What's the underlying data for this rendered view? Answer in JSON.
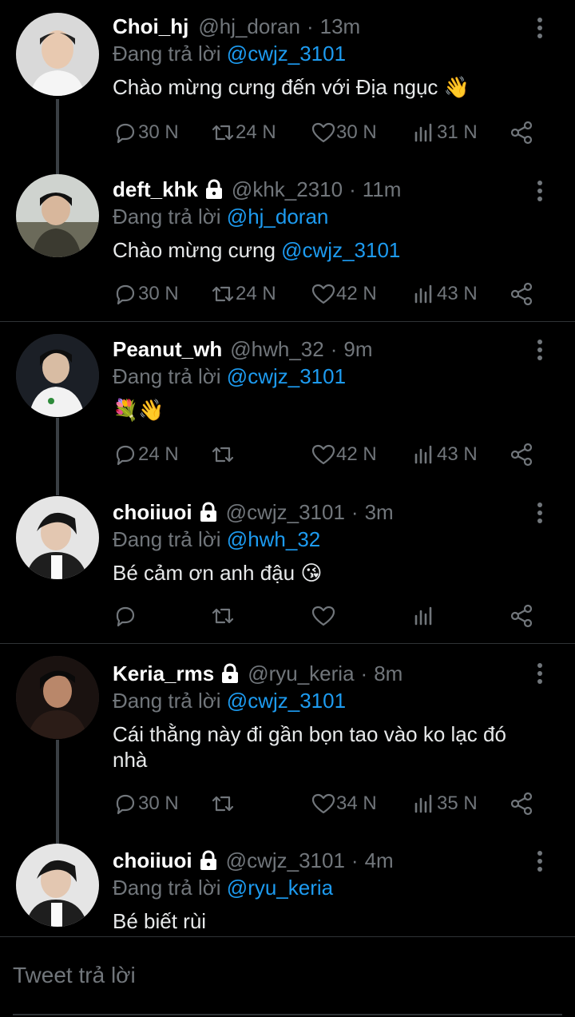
{
  "reply_prefix": "Đang trả lời",
  "tweets": [
    {
      "name": "Choi_hj",
      "handle": "@hj_doran",
      "time": "13m",
      "locked": false,
      "reply_to": "@cwjz_3101",
      "text_before": "Chào mừng cưng đến với Địa ngục ",
      "text_mention": "",
      "text_emoji": "👋",
      "replies": "30 N",
      "retweets": "24 N",
      "likes": "30 N",
      "views": "31 N"
    },
    {
      "name": "deft_khk",
      "handle": "@khk_2310",
      "time": "11m",
      "locked": true,
      "reply_to": "@hj_doran",
      "text_before": "Chào mừng cưng ",
      "text_mention": "@cwjz_3101",
      "text_emoji": "",
      "replies": "30 N",
      "retweets": "24 N",
      "likes": "42 N",
      "views": "43 N"
    },
    {
      "name": "Peanut_wh",
      "handle": "@hwh_32",
      "time": "9m",
      "locked": false,
      "reply_to": "@cwjz_3101",
      "text_before": "",
      "text_mention": "",
      "text_emoji": "💐👋",
      "replies": "24 N",
      "retweets": "",
      "likes": "42 N",
      "views": "43 N"
    },
    {
      "name": "choiiuoi",
      "handle": "@cwjz_3101",
      "time": "3m",
      "locked": true,
      "reply_to": "@hwh_32",
      "text_before": "Bé cảm ơn anh đậu ",
      "text_mention": "",
      "text_emoji": "😘",
      "replies": "",
      "retweets": "",
      "likes": "",
      "views": ""
    },
    {
      "name": "Keria_rms",
      "handle": "@ryu_keria",
      "time": "8m",
      "locked": true,
      "reply_to": "@cwjz_3101",
      "text_before": "Cái thằng này đi gần bọn tao vào ko lạc đó nhà",
      "text_mention": "",
      "text_emoji": "",
      "replies": "30 N",
      "retweets": "",
      "likes": "34 N",
      "views": "35 N"
    },
    {
      "name": "choiiuoi",
      "handle": "@cwjz_3101",
      "time": "4m",
      "locked": true,
      "reply_to": "@ryu_keria",
      "text_before": "Bé biết rùi",
      "text_mention": "",
      "text_emoji": "",
      "replies": "",
      "retweets": "",
      "likes": "",
      "views": ""
    }
  ],
  "composer": {
    "placeholder": "Tweet trả lời"
  },
  "colors": {
    "background": "#000000",
    "muted": "#71767b",
    "link": "#1d9bf0",
    "divider": "#2f3336"
  }
}
